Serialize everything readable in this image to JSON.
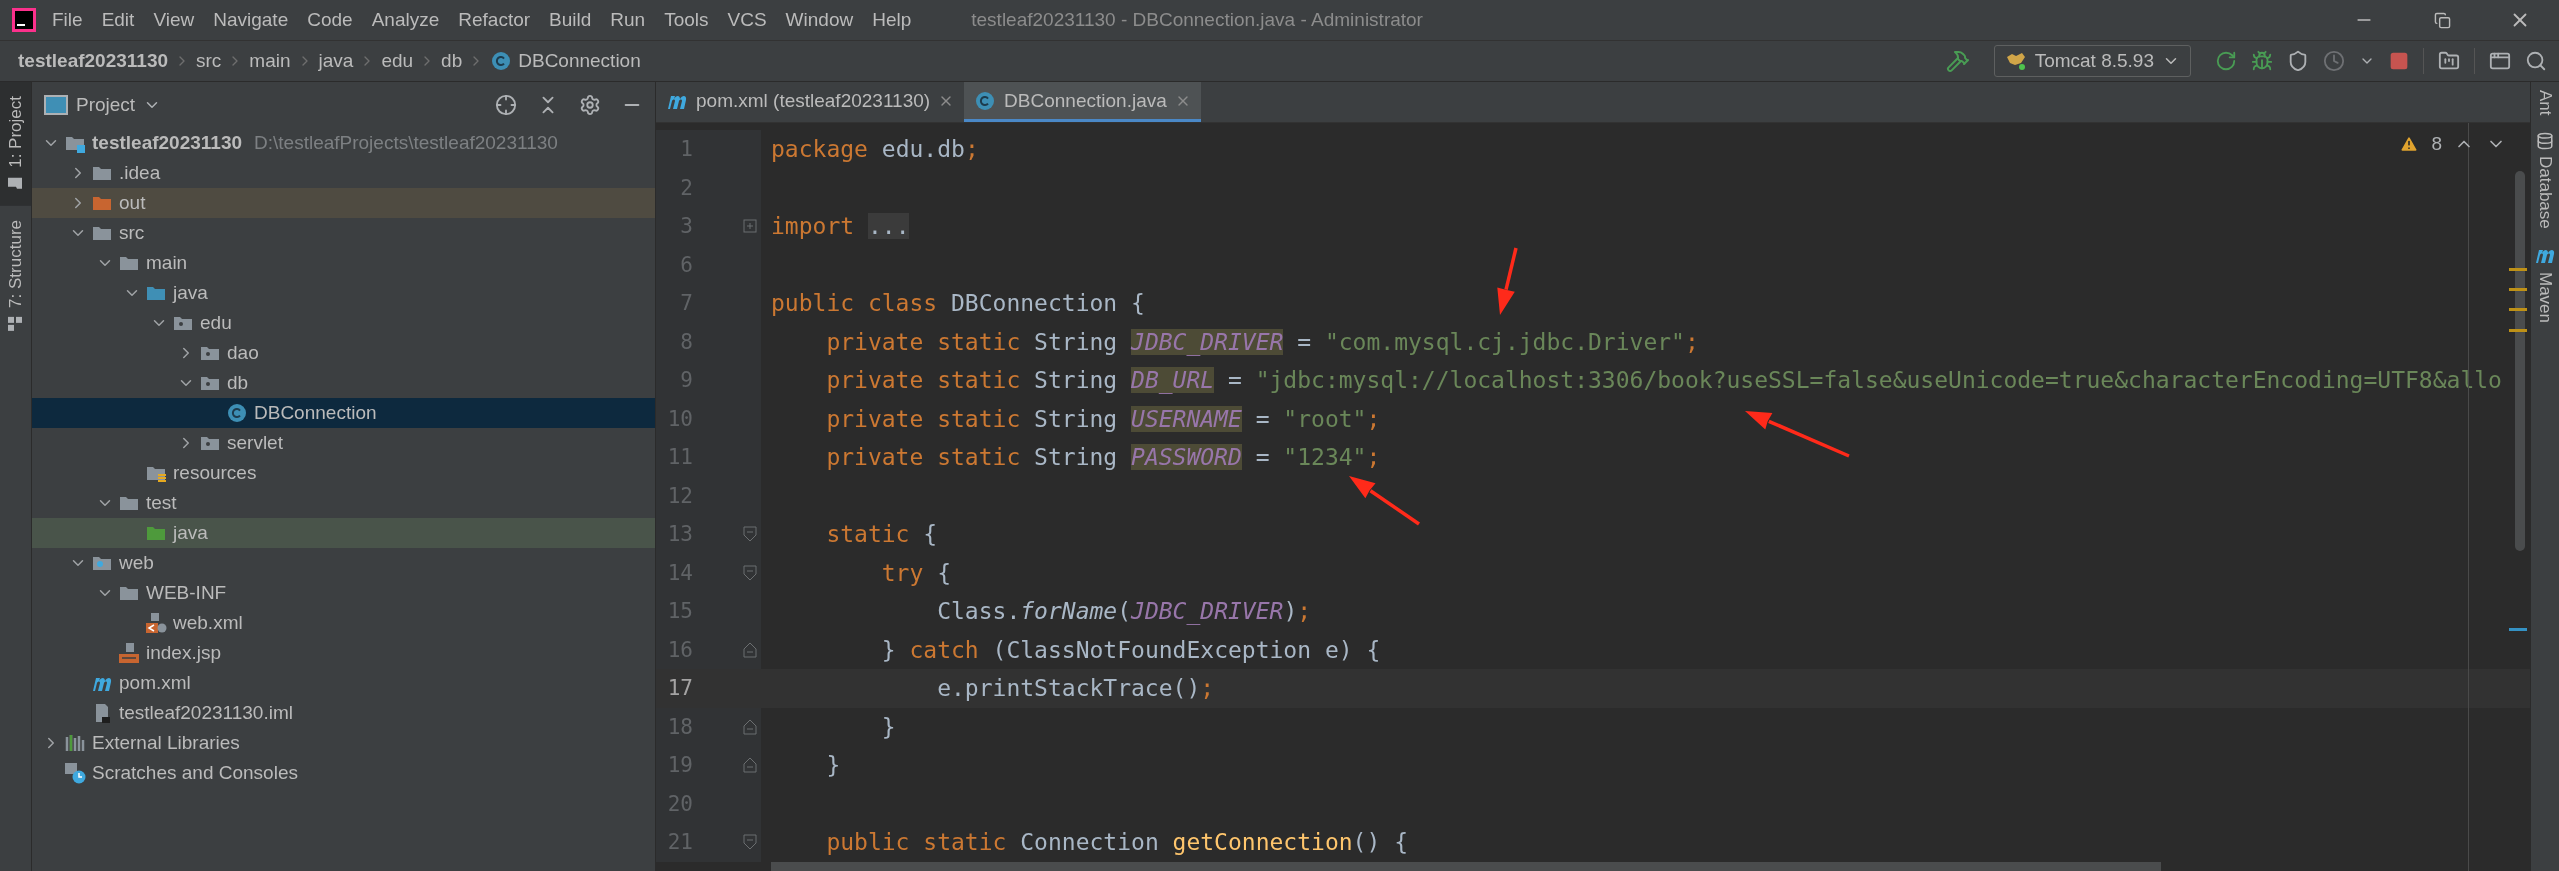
{
  "window": {
    "title": "testleaf20231130 - DBConnection.java - Administrator"
  },
  "menu": [
    "File",
    "Edit",
    "View",
    "Navigate",
    "Code",
    "Analyze",
    "Refactor",
    "Build",
    "Run",
    "Tools",
    "VCS",
    "Window",
    "Help"
  ],
  "breadcrumbs": [
    {
      "label": "testleaf20231130",
      "kind": "project"
    },
    {
      "label": "src",
      "kind": "folder"
    },
    {
      "label": "main",
      "kind": "folder"
    },
    {
      "label": "java",
      "kind": "folder"
    },
    {
      "label": "edu",
      "kind": "folder"
    },
    {
      "label": "db",
      "kind": "folder"
    },
    {
      "label": "DBConnection",
      "kind": "class"
    }
  ],
  "run_configuration": {
    "label": "Tomcat 8.5.93"
  },
  "tool_windows_left": [
    {
      "label": "1: Project",
      "selected": true
    },
    {
      "label": "7: Structure",
      "selected": false
    }
  ],
  "tool_windows_right": [
    {
      "label": "Ant",
      "kind": "plain"
    },
    {
      "label": "Database",
      "kind": "database"
    },
    {
      "label": "Maven",
      "kind": "maven"
    }
  ],
  "project_panel": {
    "title": "Project",
    "tree": [
      {
        "label": "testleaf20231130",
        "path": "D:\\testleafProjects\\testleaf20231130",
        "kind": "module",
        "expanded": true,
        "selected": false,
        "children": [
          {
            "label": ".idea",
            "kind": "folder",
            "expanded": false,
            "selected": false
          },
          {
            "label": "out",
            "kind": "excluded-folder",
            "expanded": false,
            "selected": false
          },
          {
            "label": "src",
            "kind": "folder",
            "expanded": true,
            "selected": false,
            "children": [
              {
                "label": "main",
                "kind": "folder",
                "expanded": true,
                "selected": false,
                "children": [
                  {
                    "label": "java",
                    "kind": "source-folder",
                    "expanded": true,
                    "selected": false,
                    "children": [
                      {
                        "label": "edu",
                        "kind": "package",
                        "expanded": true,
                        "selected": false,
                        "children": [
                          {
                            "label": "dao",
                            "kind": "package",
                            "expanded": false,
                            "selected": false
                          },
                          {
                            "label": "db",
                            "kind": "package",
                            "expanded": true,
                            "selected": false,
                            "children": [
                              {
                                "label": "DBConnection",
                                "kind": "class",
                                "selected": true
                              }
                            ]
                          },
                          {
                            "label": "servlet",
                            "kind": "package",
                            "expanded": false,
                            "selected": false
                          }
                        ]
                      }
                    ]
                  },
                  {
                    "label": "resources",
                    "kind": "resources-folder",
                    "selected": false
                  }
                ]
              },
              {
                "label": "test",
                "kind": "folder",
                "expanded": true,
                "selected": false,
                "children": [
                  {
                    "label": "java",
                    "kind": "test-folder",
                    "selected": false
                  }
                ]
              }
            ]
          },
          {
            "label": "web",
            "kind": "web-folder",
            "expanded": true,
            "selected": false,
            "children": [
              {
                "label": "WEB-INF",
                "kind": "folder",
                "expanded": true,
                "selected": false,
                "children": [
                  {
                    "label": "web.xml",
                    "kind": "xml",
                    "selected": false
                  }
                ]
              },
              {
                "label": "index.jsp",
                "kind": "jsp",
                "selected": false
              }
            ]
          },
          {
            "label": "pom.xml",
            "kind": "maven",
            "selected": false
          },
          {
            "label": "testleaf20231130.iml",
            "kind": "iml",
            "selected": false
          }
        ]
      },
      {
        "label": "External Libraries",
        "kind": "libraries",
        "expanded": false,
        "selected": false
      },
      {
        "label": "Scratches and Consoles",
        "kind": "scratches",
        "selected": false
      }
    ]
  },
  "editor": {
    "tabs": [
      {
        "label": "pom.xml (testleaf20231130)",
        "kind": "maven",
        "selected": false
      },
      {
        "label": "DBConnection.java",
        "kind": "class",
        "selected": true
      }
    ],
    "inspections": {
      "count": "8"
    },
    "lines": [
      {
        "number": "1",
        "current": false,
        "tokens": [
          {
            "kind": "keyword",
            "text": "package"
          },
          {
            "kind": "text",
            "text": " edu.db"
          },
          {
            "kind": "punct",
            "text": ";"
          }
        ]
      },
      {
        "number": "2",
        "current": false
      },
      {
        "number": "3",
        "current": false,
        "fold": {
          "kind": "collapsed"
        },
        "tokens": [
          {
            "kind": "keyword",
            "text": "import "
          },
          {
            "kind": "folded",
            "text": "..."
          }
        ]
      },
      {
        "number": "6",
        "current": false
      },
      {
        "number": "7",
        "current": false,
        "tokens": [
          {
            "kind": "keyword",
            "text": "public class"
          },
          {
            "kind": "text",
            "text": " DBConnection {"
          }
        ]
      },
      {
        "number": "8",
        "current": false,
        "tokens": [
          {
            "kind": "keyword",
            "text": "    private static"
          },
          {
            "kind": "text",
            "text": " String "
          },
          {
            "kind": "field-decl",
            "text": "JDBC_DRIVER"
          },
          {
            "kind": "text",
            "text": " = "
          },
          {
            "kind": "string",
            "text": "\"com.mysql.cj.jdbc.Driver\""
          },
          {
            "kind": "punct",
            "text": ";"
          }
        ]
      },
      {
        "number": "9",
        "current": false,
        "tokens": [
          {
            "kind": "keyword",
            "text": "    private static"
          },
          {
            "kind": "text",
            "text": " String "
          },
          {
            "kind": "field-decl",
            "text": "DB_URL"
          },
          {
            "kind": "text",
            "text": " = "
          },
          {
            "kind": "string",
            "text": "\"jdbc:mysql://localhost:3306/book?useSSL=false&useUnicode=true&characterEncoding=UTF8&allo"
          }
        ]
      },
      {
        "number": "10",
        "current": false,
        "tokens": [
          {
            "kind": "keyword",
            "text": "    private static"
          },
          {
            "kind": "text",
            "text": " String "
          },
          {
            "kind": "field-decl",
            "text": "USERNAME"
          },
          {
            "kind": "text",
            "text": " = "
          },
          {
            "kind": "string",
            "text": "\"root\""
          },
          {
            "kind": "punct",
            "text": ";"
          }
        ]
      },
      {
        "number": "11",
        "current": false,
        "tokens": [
          {
            "kind": "keyword",
            "text": "    private static"
          },
          {
            "kind": "text",
            "text": " String "
          },
          {
            "kind": "field-decl",
            "text": "PASSWORD"
          },
          {
            "kind": "text",
            "text": " = "
          },
          {
            "kind": "string",
            "text": "\"1234\""
          },
          {
            "kind": "punct",
            "text": ";"
          }
        ]
      },
      {
        "number": "12",
        "current": false
      },
      {
        "number": "13",
        "current": false,
        "fold": {
          "kind": "start"
        },
        "tokens": [
          {
            "kind": "keyword",
            "text": "    static"
          },
          {
            "kind": "text",
            "text": " {"
          }
        ]
      },
      {
        "number": "14",
        "current": false,
        "fold": {
          "kind": "start"
        },
        "tokens": [
          {
            "kind": "keyword",
            "text": "        try"
          },
          {
            "kind": "text",
            "text": " {"
          }
        ]
      },
      {
        "number": "15",
        "current": false,
        "tokens": [
          {
            "kind": "text",
            "text": "            Class."
          },
          {
            "kind": "static-call",
            "text": "forName"
          },
          {
            "kind": "text",
            "text": "("
          },
          {
            "kind": "field",
            "text": "JDBC_DRIVER"
          },
          {
            "kind": "text",
            "text": ")"
          },
          {
            "kind": "punct",
            "text": ";"
          }
        ]
      },
      {
        "number": "16",
        "current": false,
        "fold": {
          "kind": "end"
        },
        "tokens": [
          {
            "kind": "text",
            "text": "        } "
          },
          {
            "kind": "keyword",
            "text": "catch"
          },
          {
            "kind": "text",
            "text": " (ClassNotFoundException e) {"
          }
        ]
      },
      {
        "number": "17",
        "current": true,
        "tokens": [
          {
            "kind": "text",
            "text": "            e.printStackTrace()"
          },
          {
            "kind": "punct",
            "text": ";"
          }
        ]
      },
      {
        "number": "18",
        "current": false,
        "fold": {
          "kind": "end"
        },
        "tokens": [
          {
            "kind": "text",
            "text": "        }"
          }
        ]
      },
      {
        "number": "19",
        "current": false,
        "fold": {
          "kind": "end"
        },
        "tokens": [
          {
            "kind": "text",
            "text": "    }"
          }
        ]
      },
      {
        "number": "20",
        "current": false
      },
      {
        "number": "21",
        "current": false,
        "fold": {
          "kind": "start"
        },
        "tokens": [
          {
            "kind": "keyword",
            "text": "    public static"
          },
          {
            "kind": "text",
            "text": " Connection "
          },
          {
            "kind": "method",
            "text": "getConnection"
          },
          {
            "kind": "text",
            "text": "() {"
          }
        ]
      }
    ]
  }
}
